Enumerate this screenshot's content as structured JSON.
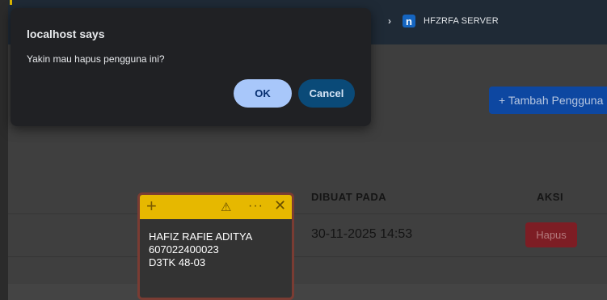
{
  "browser": {
    "tab_label": "HFZRFA SERVER",
    "tab_logo_letter": "n"
  },
  "dialog": {
    "title": "localhost says",
    "message": "Yakin mau hapus pengguna ini?",
    "ok_label": "OK",
    "cancel_label": "Cancel"
  },
  "page": {
    "add_button_label": "+ Tambah Pengguna",
    "table": {
      "columns": [
        "DIBUAT PADA",
        "AKSI"
      ],
      "rows": [
        {
          "created_at": "30-11-2025 14:53",
          "action_label": "Hapus"
        }
      ]
    }
  },
  "sticky_note": {
    "lines": [
      "HAFIZ RAFIE ADITYA",
      "607022400023",
      "D3TK 48-03"
    ]
  },
  "colors": {
    "accent_blue": "#a8c7fa",
    "cancel_blue": "#0a4a78",
    "danger": "#7d1d24",
    "sticky_header": "#e6b800"
  }
}
